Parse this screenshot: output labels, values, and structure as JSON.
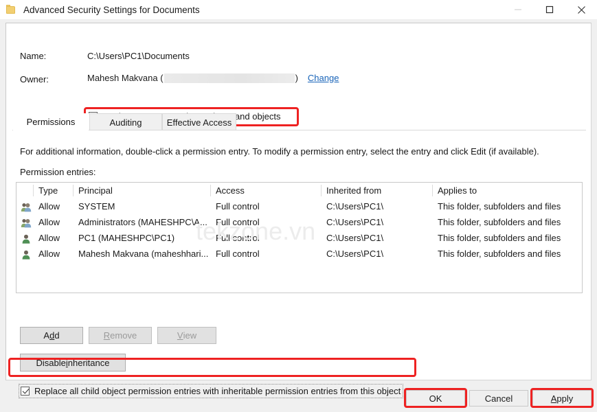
{
  "window": {
    "title": "Advanced Security Settings for Documents",
    "icon": "folder-icon",
    "minimize_label": "—",
    "maximize_label": "☐",
    "close_label": "✕"
  },
  "header": {
    "name_label": "Name:",
    "name_value": "C:\\Users\\PC1\\Documents",
    "owner_label": "Owner:",
    "owner_value_prefix": "Mahesh Makvana (",
    "owner_value_suffix": ")",
    "owner_redacted": "",
    "change_link_accel": "C",
    "change_link_rest": "hange",
    "replace_owner_checkbox": {
      "label": "Replace owner on subcontainers and objects",
      "checked": true
    }
  },
  "tabs": [
    {
      "label": "Permissions",
      "active": true
    },
    {
      "label": "Auditing",
      "active": false
    },
    {
      "label": "Effective Access",
      "active": false
    }
  ],
  "main": {
    "info_text": "For additional information, double-click a permission entry. To modify a permission entry, select the entry and click Edit (if available).",
    "entries_label": "Permission entries:",
    "columns": [
      "Type",
      "Principal",
      "Access",
      "Inherited from",
      "Applies to"
    ],
    "rows": [
      {
        "icon": "group-icon",
        "type": "Allow",
        "principal": "SYSTEM",
        "access": "Full control",
        "inherited_from": "C:\\Users\\PC1\\",
        "applies_to": "This folder, subfolders and files"
      },
      {
        "icon": "group-icon",
        "type": "Allow",
        "principal": "Administrators (MAHESHPC\\A...",
        "access": "Full control",
        "inherited_from": "C:\\Users\\PC1\\",
        "applies_to": "This folder, subfolders and files"
      },
      {
        "icon": "user-icon",
        "type": "Allow",
        "principal": "PC1 (MAHESHPC\\PC1)",
        "access": "Full control",
        "inherited_from": "C:\\Users\\PC1\\",
        "applies_to": "This folder, subfolders and files"
      },
      {
        "icon": "user-icon",
        "type": "Allow",
        "principal": "Mahesh Makvana (maheshhari...",
        "access": "Full control",
        "inherited_from": "C:\\Users\\PC1\\",
        "applies_to": "This folder, subfolders and files"
      }
    ],
    "watermark": "tekzone.vn"
  },
  "actions": {
    "add": {
      "accel": "A",
      "pre": "A",
      "mid": "d",
      "post": "d",
      "label": "Add",
      "enabled": true
    },
    "remove": {
      "label": "Remove",
      "enabled": false
    },
    "view": {
      "label": "View",
      "enabled": false
    },
    "disable_inheritance": {
      "label": "Disable inheritance",
      "enabled": true
    }
  },
  "replace_child_checkbox": {
    "label": "Replace all child object permission entries with inheritable permission entries from this object",
    "checked": true
  },
  "footer": {
    "ok": "OK",
    "cancel": "Cancel",
    "apply_accel": "A",
    "apply_rest": "pply",
    "apply": "Apply"
  },
  "colors": {
    "annotation_red": "#ee2222",
    "link_blue": "#1763b8",
    "window_bg": "#f0f0f0",
    "panel_bg": "#ffffff"
  }
}
